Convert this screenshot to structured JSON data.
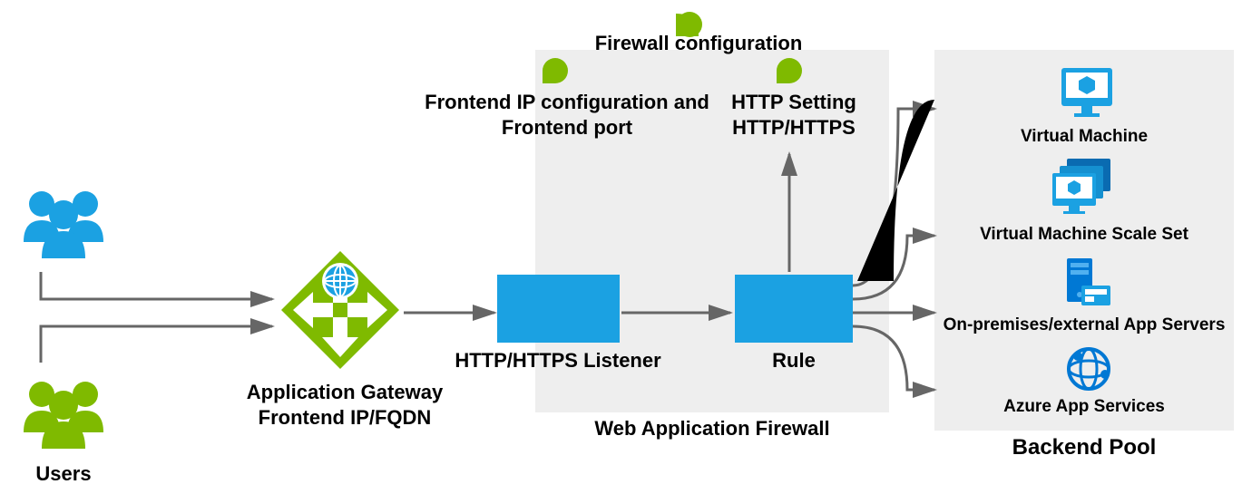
{
  "left": {
    "users_label": "Users"
  },
  "gateway": {
    "label_line1": "Application Gateway",
    "label_line2": "Frontend IP/FQDN"
  },
  "waf": {
    "firewall_config_label": "Firewall configuration",
    "frontend_ip_line1": "Frontend IP configuration and",
    "frontend_ip_line2": "Frontend port",
    "http_setting_line1": "HTTP Setting",
    "http_setting_line2": "HTTP/HTTPS",
    "listener_label": "HTTP/HTTPS Listener",
    "rule_label": "Rule",
    "panel_label": "Web Application Firewall"
  },
  "backend": {
    "panel_label": "Backend Pool",
    "items": [
      "Virtual Machine",
      "Virtual Machine Scale Set",
      "On-premises/external App Servers",
      "Azure App Services"
    ]
  },
  "colors": {
    "azure_blue": "#1ba1e2",
    "azure_blue_dark": "#0078d4",
    "green": "#7fba00",
    "grey_panel": "#eeeeee",
    "arrow": "#666666"
  }
}
